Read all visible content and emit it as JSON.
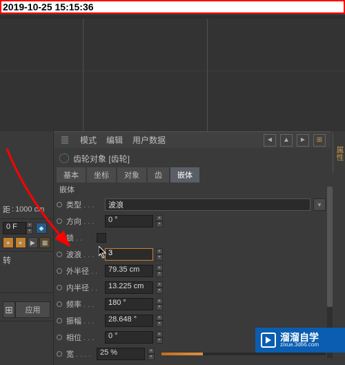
{
  "timestamp": "2019-10-25 15:15:36",
  "menu": {
    "mode": "模式",
    "edit": "编辑",
    "user_data": "用户数据"
  },
  "object_header": "齿轮对象 [齿轮]",
  "tabs": [
    "基本",
    "坐标",
    "对象",
    "齿",
    "嵌体"
  ],
  "active_tab": "嵌体",
  "section_label": "嵌体",
  "params": {
    "type_label": "类型",
    "type_value": "波浪",
    "direction_label": "方向",
    "direction_value": "0 °",
    "lock_label": "锁",
    "wave_label": "波浪",
    "wave_value": "3",
    "outer_r_label": "外半径",
    "outer_r_value": "79.35 cm",
    "inner_r_label": "内半径",
    "inner_r_value": "13.225 cm",
    "freq_label": "频率",
    "freq_value": "180 °",
    "amp_label": "振幅",
    "amp_value": "28.648 °",
    "phase_label": "相位",
    "phase_value": "0 °",
    "width_label": "宽",
    "width_value": "25 %"
  },
  "left": {
    "dist_label": "距",
    "dist_value": "1000 cm",
    "frame_value": "0 F",
    "rotate_label": "转",
    "apply_btn": "应用"
  },
  "right_tab": "属性",
  "watermark": {
    "cn": "溜溜自学",
    "url": "zixue.3d66.com"
  }
}
